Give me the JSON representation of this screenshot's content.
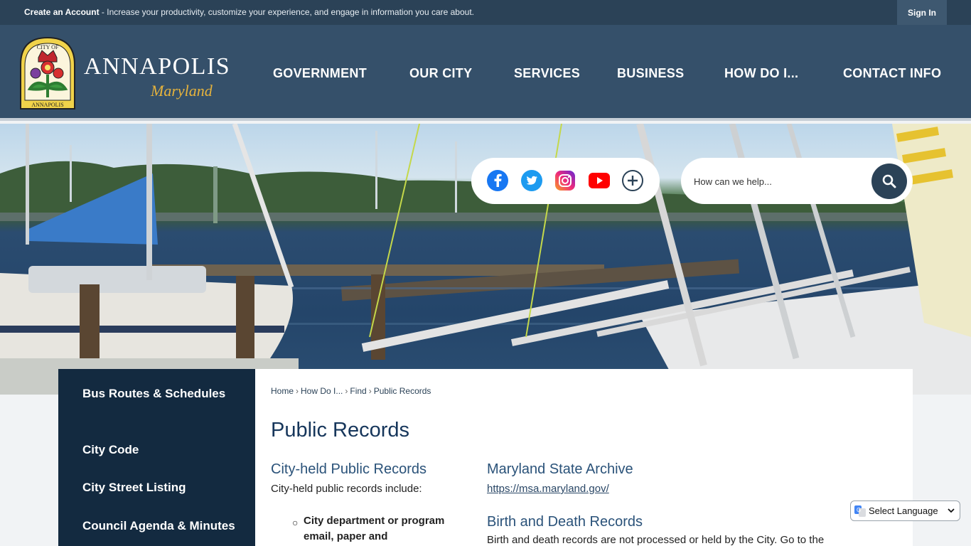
{
  "topbar": {
    "create_account_label": "Create an Account",
    "message": " - Increase your productivity, customize your experience, and engage in information you care about.",
    "sign_in_label": "Sign In"
  },
  "header": {
    "logo_title": "ANNAPOLIS",
    "logo_subtitle": "Maryland",
    "seal_text_top": "CITY OF",
    "seal_text_bottom": "ANNAPOLIS",
    "nav": [
      "GOVERNMENT",
      "OUR CITY",
      "SERVICES",
      "BUSINESS",
      "HOW DO I...",
      "CONTACT INFO"
    ]
  },
  "social": {
    "icons": [
      "facebook-icon",
      "twitter-icon",
      "instagram-icon",
      "youtube-icon",
      "plus-icon"
    ],
    "colors": {
      "facebook": "#1877f2",
      "twitter": "#1d9bf0",
      "youtube": "#ff0000",
      "plus": "#2b4257"
    }
  },
  "search": {
    "placeholder": "How can we help..."
  },
  "sidebar": {
    "items": [
      {
        "label": "Bus Routes & Schedules"
      },
      {
        "label": "City Code"
      },
      {
        "label": "City Street Listing"
      },
      {
        "label": "Council Agenda & Minutes"
      }
    ]
  },
  "breadcrumb": [
    "Home",
    "How Do I...",
    "Find",
    "Public Records"
  ],
  "content": {
    "title": "Public Records",
    "city_held": {
      "heading": "City-held Public Records",
      "intro": "City-held public records include:",
      "bullet": "City department or program email, paper and"
    },
    "archive": {
      "heading": "Maryland State  Archive",
      "link": "https://msa.maryland.gov/"
    },
    "birth_death": {
      "heading": "Birth and Death Records",
      "text": " Birth and death records are not processed or held by the City. Go to the"
    }
  },
  "translate": {
    "label": "Select Language"
  },
  "colors": {
    "topbar": "#2b4257",
    "header": "#35506a",
    "sidebar": "#132a40",
    "heading": "#2a5279",
    "logo_gold": "#e6b33c"
  }
}
